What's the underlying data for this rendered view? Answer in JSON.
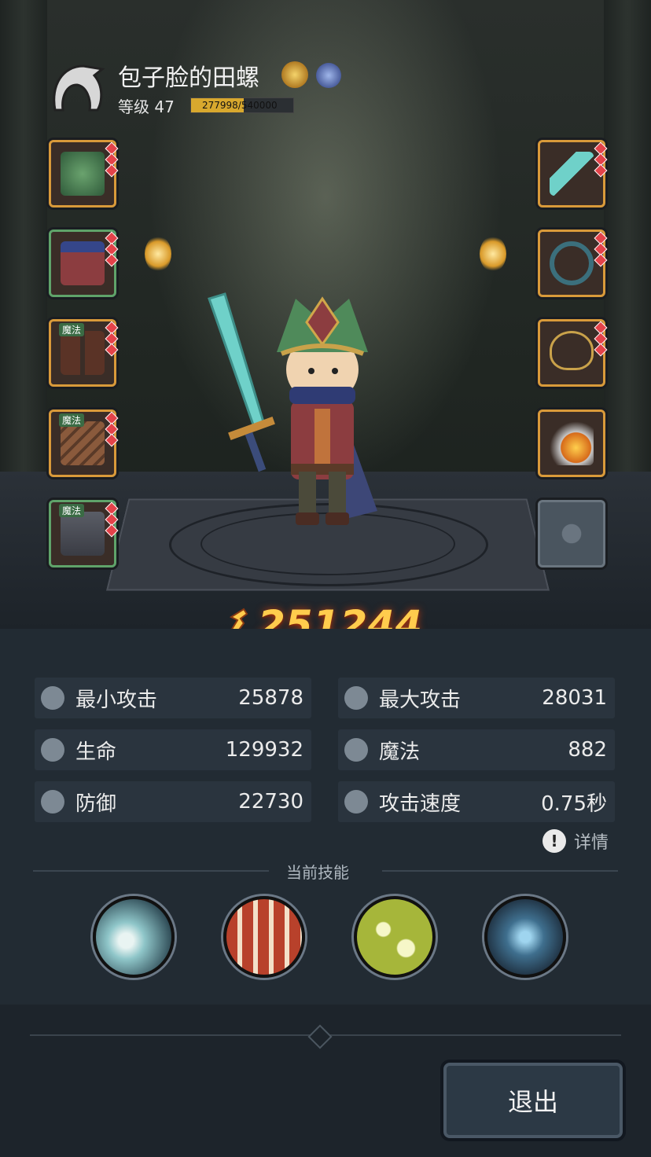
{
  "player": {
    "name": "包子脸的田螺",
    "level_label": "等级 47",
    "xp_text": "277998/540000",
    "xp_fraction": 0.5148
  },
  "combat_power": "251244",
  "equipment_left": [
    {
      "slot": "helmet",
      "tag": "",
      "frame": "gold"
    },
    {
      "slot": "armor",
      "tag": "",
      "frame": "green"
    },
    {
      "slot": "boots",
      "tag": "魔法",
      "frame": "gold"
    },
    {
      "slot": "gloves",
      "tag": "魔法",
      "frame": "gold"
    },
    {
      "slot": "cloak",
      "tag": "魔法",
      "frame": "green"
    }
  ],
  "equipment_right": [
    {
      "slot": "sword",
      "frame": "gold"
    },
    {
      "slot": "ring",
      "frame": "gold"
    },
    {
      "slot": "necklace",
      "frame": "gold"
    },
    {
      "slot": "charm",
      "frame": "gold"
    }
  ],
  "stats": [
    {
      "label": "最小攻击",
      "value": "25878",
      "icon": "sword-icon"
    },
    {
      "label": "最大攻击",
      "value": "28031",
      "icon": "sword-icon"
    },
    {
      "label": "生命",
      "value": "129932",
      "icon": "heart-icon"
    },
    {
      "label": "魔法",
      "value": "882",
      "icon": "magic-icon"
    },
    {
      "label": "防御",
      "value": "22730",
      "icon": "shield-icon"
    },
    {
      "label": "攻击速度",
      "value": "0.75秒",
      "icon": "speed-icon"
    }
  ],
  "details_label": "详情",
  "skills_title": "当前技能",
  "skills": [
    {
      "icon": "frost-burst-icon",
      "color": "#8fc6c9"
    },
    {
      "icon": "fire-slash-icon",
      "color": "#b8412b"
    },
    {
      "icon": "poison-orbs-icon",
      "color": "#a6b63a"
    },
    {
      "icon": "water-shield-icon",
      "color": "#3f6f8e"
    }
  ],
  "exit_label": "退出",
  "colors": {
    "power": "#ffcc4d",
    "panel": "#222b33",
    "accent_gold": "#d99a3a",
    "accent_green": "#5fa36a"
  }
}
